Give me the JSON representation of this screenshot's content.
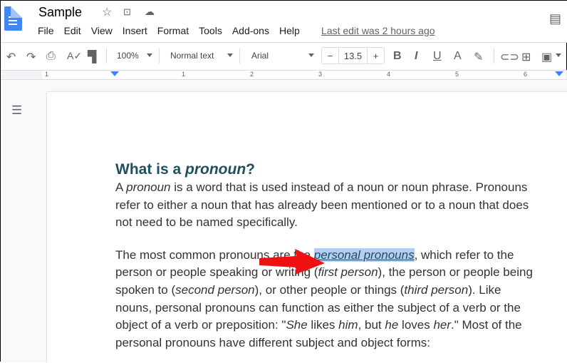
{
  "app": {
    "title": "Sample",
    "last_edit": "Last edit was 2 hours ago"
  },
  "menu": [
    "File",
    "Edit",
    "View",
    "Insert",
    "Format",
    "Tools",
    "Add-ons",
    "Help"
  ],
  "toolbar": {
    "zoom": "100%",
    "style": "Normal text",
    "font": "Arial",
    "font_size": "13.5",
    "minus": "−",
    "plus": "+",
    "bold": "B",
    "italic": "I",
    "underline": "U",
    "text_color": "A"
  },
  "ruler": [
    "1",
    "1",
    "2",
    "3",
    "4",
    "5",
    "6"
  ],
  "document": {
    "heading": [
      {
        "t": "What is a "
      },
      {
        "t": "pronoun",
        "i": true
      },
      {
        "t": "?"
      }
    ],
    "lines": [
      [
        {
          "t": "A "
        },
        {
          "t": "pronoun",
          "i": true
        },
        {
          "t": " is a word that is used instead of a noun or noun phrase. Pronouns"
        }
      ],
      [
        {
          "t": "refer to either a noun that has already been mentioned or to a noun that does"
        }
      ],
      [
        {
          "t": "not need to be named specifically."
        }
      ],
      null,
      [
        {
          "t": "The most common pronouns are the "
        },
        {
          "t": "personal pronouns",
          "i": true,
          "hl": true
        },
        {
          "t": ", which refer to the"
        }
      ],
      [
        {
          "t": "person or people speaking or writing ("
        },
        {
          "t": "first person",
          "i": true
        },
        {
          "t": "), the person or people being"
        }
      ],
      [
        {
          "t": "spoken to ("
        },
        {
          "t": "second person",
          "i": true
        },
        {
          "t": "), or other people or things ("
        },
        {
          "t": "third person",
          "i": true
        },
        {
          "t": "). Like"
        }
      ],
      [
        {
          "t": "nouns, personal pronouns can function as either the subject of a verb or the"
        }
      ],
      [
        {
          "t": "object of a verb or preposition: \""
        },
        {
          "t": "She",
          "i": true
        },
        {
          "t": " likes "
        },
        {
          "t": "him",
          "i": true
        },
        {
          "t": ", but "
        },
        {
          "t": "he",
          "i": true
        },
        {
          "t": " loves "
        },
        {
          "t": "her",
          "i": true
        },
        {
          "t": ".\" Most of the"
        }
      ],
      [
        {
          "t": "personal pronouns have different subject and object forms:"
        }
      ]
    ]
  },
  "colors": {
    "accent": "#4285f4",
    "highlight": "#b4cdf5",
    "heading": "#1f4e5f",
    "arrow": "#ee1111"
  }
}
